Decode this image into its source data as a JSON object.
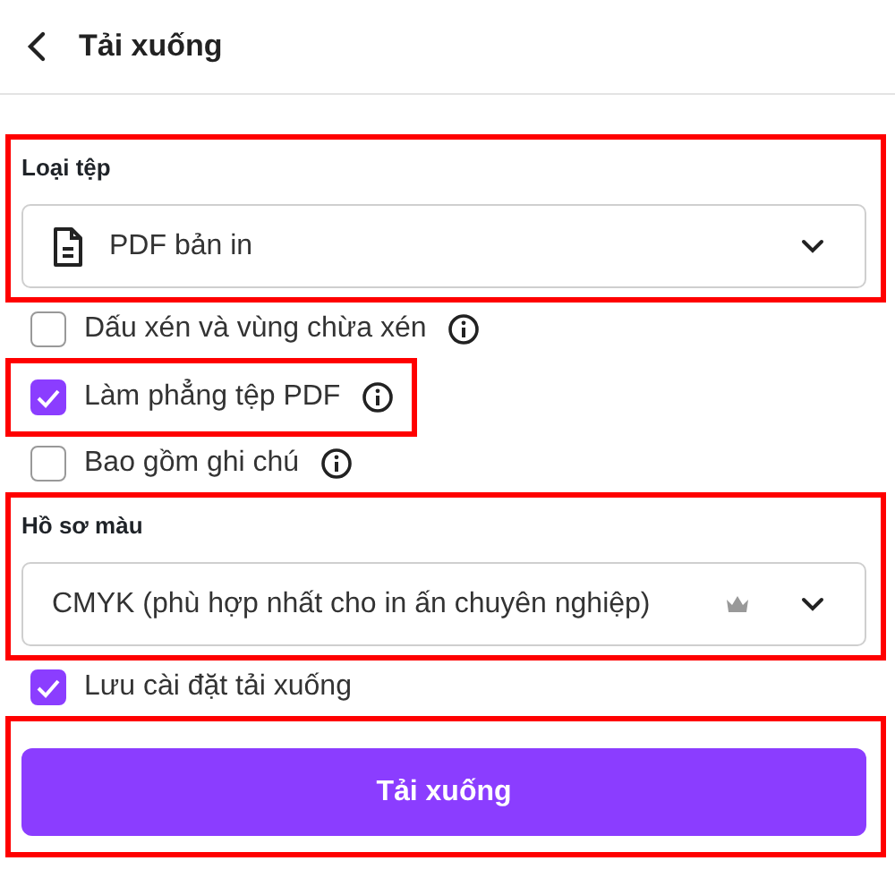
{
  "header": {
    "title": "Tải xuống"
  },
  "items": [
    {
      "kind": "select",
      "label": "Loại tệp",
      "value": "PDF bản in",
      "leading_icon": true,
      "premium": false,
      "highlighted": true
    },
    {
      "kind": "checkbox",
      "label": "Dấu xén và vùng chừa xén",
      "checked": false,
      "info": true,
      "highlighted": false
    },
    {
      "kind": "checkbox",
      "label": "Làm phẳng tệp PDF",
      "checked": true,
      "info": true,
      "highlighted": true
    },
    {
      "kind": "checkbox",
      "label": "Bao gồm ghi chú",
      "checked": false,
      "info": true,
      "highlighted": false
    },
    {
      "kind": "select",
      "label": "Hồ sơ màu",
      "value": "CMYK (phù hợp nhất cho in ấn chuyên nghiệp)",
      "leading_icon": false,
      "premium": true,
      "highlighted": true
    },
    {
      "kind": "checkbox",
      "label": "Lưu cài đặt tải xuống",
      "checked": true,
      "info": false,
      "highlighted": false
    },
    {
      "kind": "button",
      "label": "Tải xuống",
      "highlighted": true
    }
  ]
}
